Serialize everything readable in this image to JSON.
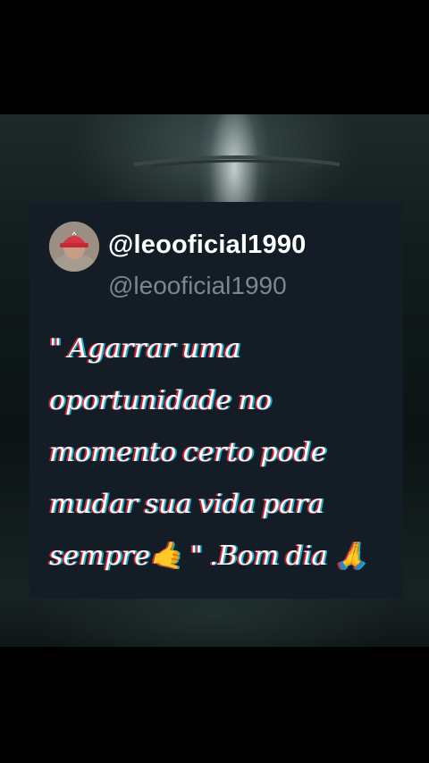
{
  "post": {
    "display_name": "@leooficial1990",
    "handle": "@leooficial1990",
    "avatar_icon": "avatar-icon",
    "quote_text": "\" Agarrar uma oportunidade no momento certo pode mudar sua vida para sempre🤙 \" .Bom dia 🙏"
  },
  "colors": {
    "card_bg": "#141d25",
    "name": "#ffffff",
    "handle": "#7d858d"
  }
}
